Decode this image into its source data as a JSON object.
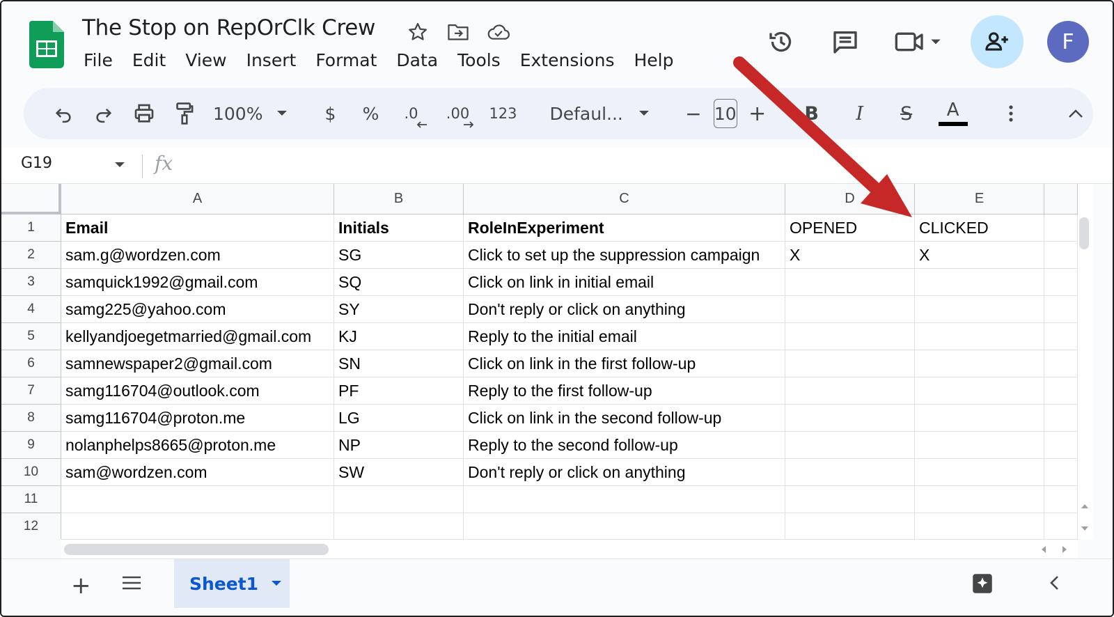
{
  "doc": {
    "title": "The Stop on RepOrClk Crew",
    "avatar_letter": "F"
  },
  "menu": [
    "File",
    "Edit",
    "View",
    "Insert",
    "Format",
    "Data",
    "Tools",
    "Extensions",
    "Help"
  ],
  "toolbar": {
    "zoom": "100%",
    "currency": "$",
    "percent": "%",
    "dec_decrease": ".0",
    "dec_increase": ".00",
    "number_format": "123",
    "font": "Defaul...",
    "minus": "−",
    "font_size": "10",
    "plus": "+",
    "bold": "B",
    "italic": "I",
    "strike": "S",
    "text_color": "A"
  },
  "formula_bar": {
    "cell_ref": "G19",
    "fx": "fx"
  },
  "sheet": {
    "columns": [
      "A",
      "B",
      "C",
      "D",
      "E"
    ],
    "row_numbers": [
      "1",
      "2",
      "3",
      "4",
      "5",
      "6",
      "7",
      "8",
      "9",
      "10",
      "11",
      "12"
    ],
    "rows": [
      [
        "Email",
        "Initials",
        "RoleInExperiment",
        "OPENED",
        "CLICKED"
      ],
      [
        "sam.g@wordzen.com",
        "SG",
        "Click to set up the suppression campaign",
        "X",
        "X"
      ],
      [
        "samquick1992@gmail.com",
        "SQ",
        "Click on link in initial email",
        "",
        ""
      ],
      [
        "samg225@yahoo.com",
        "SY",
        "Don't reply or click on anything",
        "",
        ""
      ],
      [
        "kellyandjoegetmarried@gmail.com",
        "KJ",
        "Reply to the initial email",
        "",
        ""
      ],
      [
        "samnewspaper2@gmail.com",
        "SN",
        "Click on link in the first follow-up",
        "",
        ""
      ],
      [
        "samg116704@outlook.com",
        "PF",
        "Reply to the first follow-up",
        "",
        ""
      ],
      [
        "samg116704@proton.me",
        "LG",
        "Click on link in the second follow-up",
        "",
        ""
      ],
      [
        "nolanphelps8665@proton.me",
        "NP",
        "Reply to the second follow-up",
        "",
        ""
      ],
      [
        "sam@wordzen.com",
        "SW",
        "Don't reply or click on anything",
        "",
        ""
      ],
      [
        "",
        "",
        "",
        "",
        ""
      ],
      [
        "",
        "",
        "",
        "",
        ""
      ]
    ]
  },
  "tabs": {
    "add": "+",
    "active_sheet": "Sheet1"
  },
  "colors": {
    "sheets_green": "#0f9d58",
    "share_bg": "#c2e7ff",
    "avatar_bg": "#5c6bc0",
    "tab_active_bg": "#e1e9f7",
    "tab_active_text": "#0b57d0",
    "annotation_arrow": "#c62828"
  },
  "icons": {
    "logo": "google-sheets-logo",
    "star": "star-icon",
    "move": "move-to-folder-icon",
    "cloud": "cloud-saved-icon",
    "history": "version-history-icon",
    "comments": "comments-icon",
    "meet": "meet-video-icon",
    "share": "share-person-add-icon",
    "undo": "undo-icon",
    "redo": "redo-icon",
    "print": "print-icon",
    "paint": "paint-format-icon",
    "more": "more-vert-icon",
    "collapse": "chevron-up-icon"
  }
}
